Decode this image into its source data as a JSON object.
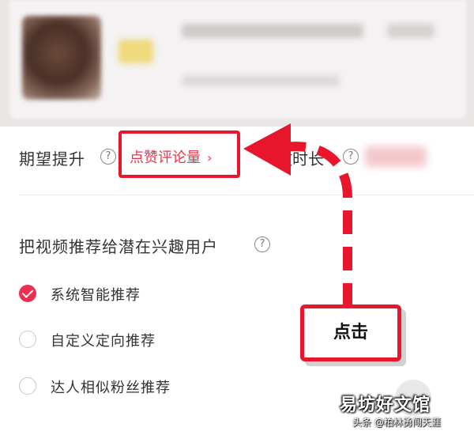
{
  "expect": {
    "label": "期望提升",
    "help": "?",
    "option": "点赞评论量",
    "option_chevron": "›",
    "duration_label": "放时长"
  },
  "push": {
    "label": "把视频推荐给潜在兴趣用户",
    "help": "?",
    "options": [
      {
        "label": "系统智能推荐",
        "checked": true
      },
      {
        "label": "自定义定向推荐",
        "checked": false
      },
      {
        "label": "达人相似粉丝推荐",
        "checked": false
      }
    ]
  },
  "callout": {
    "text": "点击"
  },
  "watermark": {
    "main": "易坊好文馆",
    "sub": "头条 @柏林勇闯天涯"
  },
  "colors": {
    "accent": "#e8162c",
    "check": "#ee2e4e",
    "link": "#e8364a"
  }
}
